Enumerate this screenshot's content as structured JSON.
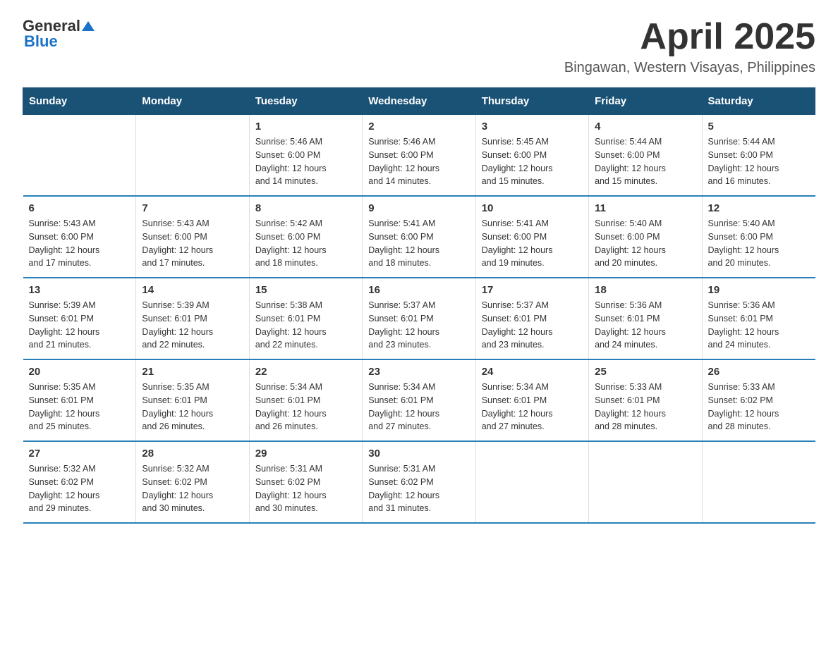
{
  "header": {
    "logo_text_general": "General",
    "logo_text_blue": "Blue",
    "month_title": "April 2025",
    "location": "Bingawan, Western Visayas, Philippines"
  },
  "calendar": {
    "headers": [
      "Sunday",
      "Monday",
      "Tuesday",
      "Wednesday",
      "Thursday",
      "Friday",
      "Saturday"
    ],
    "rows": [
      [
        {
          "day": "",
          "info": ""
        },
        {
          "day": "",
          "info": ""
        },
        {
          "day": "1",
          "info": "Sunrise: 5:46 AM\nSunset: 6:00 PM\nDaylight: 12 hours\nand 14 minutes."
        },
        {
          "day": "2",
          "info": "Sunrise: 5:46 AM\nSunset: 6:00 PM\nDaylight: 12 hours\nand 14 minutes."
        },
        {
          "day": "3",
          "info": "Sunrise: 5:45 AM\nSunset: 6:00 PM\nDaylight: 12 hours\nand 15 minutes."
        },
        {
          "day": "4",
          "info": "Sunrise: 5:44 AM\nSunset: 6:00 PM\nDaylight: 12 hours\nand 15 minutes."
        },
        {
          "day": "5",
          "info": "Sunrise: 5:44 AM\nSunset: 6:00 PM\nDaylight: 12 hours\nand 16 minutes."
        }
      ],
      [
        {
          "day": "6",
          "info": "Sunrise: 5:43 AM\nSunset: 6:00 PM\nDaylight: 12 hours\nand 17 minutes."
        },
        {
          "day": "7",
          "info": "Sunrise: 5:43 AM\nSunset: 6:00 PM\nDaylight: 12 hours\nand 17 minutes."
        },
        {
          "day": "8",
          "info": "Sunrise: 5:42 AM\nSunset: 6:00 PM\nDaylight: 12 hours\nand 18 minutes."
        },
        {
          "day": "9",
          "info": "Sunrise: 5:41 AM\nSunset: 6:00 PM\nDaylight: 12 hours\nand 18 minutes."
        },
        {
          "day": "10",
          "info": "Sunrise: 5:41 AM\nSunset: 6:00 PM\nDaylight: 12 hours\nand 19 minutes."
        },
        {
          "day": "11",
          "info": "Sunrise: 5:40 AM\nSunset: 6:00 PM\nDaylight: 12 hours\nand 20 minutes."
        },
        {
          "day": "12",
          "info": "Sunrise: 5:40 AM\nSunset: 6:00 PM\nDaylight: 12 hours\nand 20 minutes."
        }
      ],
      [
        {
          "day": "13",
          "info": "Sunrise: 5:39 AM\nSunset: 6:01 PM\nDaylight: 12 hours\nand 21 minutes."
        },
        {
          "day": "14",
          "info": "Sunrise: 5:39 AM\nSunset: 6:01 PM\nDaylight: 12 hours\nand 22 minutes."
        },
        {
          "day": "15",
          "info": "Sunrise: 5:38 AM\nSunset: 6:01 PM\nDaylight: 12 hours\nand 22 minutes."
        },
        {
          "day": "16",
          "info": "Sunrise: 5:37 AM\nSunset: 6:01 PM\nDaylight: 12 hours\nand 23 minutes."
        },
        {
          "day": "17",
          "info": "Sunrise: 5:37 AM\nSunset: 6:01 PM\nDaylight: 12 hours\nand 23 minutes."
        },
        {
          "day": "18",
          "info": "Sunrise: 5:36 AM\nSunset: 6:01 PM\nDaylight: 12 hours\nand 24 minutes."
        },
        {
          "day": "19",
          "info": "Sunrise: 5:36 AM\nSunset: 6:01 PM\nDaylight: 12 hours\nand 24 minutes."
        }
      ],
      [
        {
          "day": "20",
          "info": "Sunrise: 5:35 AM\nSunset: 6:01 PM\nDaylight: 12 hours\nand 25 minutes."
        },
        {
          "day": "21",
          "info": "Sunrise: 5:35 AM\nSunset: 6:01 PM\nDaylight: 12 hours\nand 26 minutes."
        },
        {
          "day": "22",
          "info": "Sunrise: 5:34 AM\nSunset: 6:01 PM\nDaylight: 12 hours\nand 26 minutes."
        },
        {
          "day": "23",
          "info": "Sunrise: 5:34 AM\nSunset: 6:01 PM\nDaylight: 12 hours\nand 27 minutes."
        },
        {
          "day": "24",
          "info": "Sunrise: 5:34 AM\nSunset: 6:01 PM\nDaylight: 12 hours\nand 27 minutes."
        },
        {
          "day": "25",
          "info": "Sunrise: 5:33 AM\nSunset: 6:01 PM\nDaylight: 12 hours\nand 28 minutes."
        },
        {
          "day": "26",
          "info": "Sunrise: 5:33 AM\nSunset: 6:02 PM\nDaylight: 12 hours\nand 28 minutes."
        }
      ],
      [
        {
          "day": "27",
          "info": "Sunrise: 5:32 AM\nSunset: 6:02 PM\nDaylight: 12 hours\nand 29 minutes."
        },
        {
          "day": "28",
          "info": "Sunrise: 5:32 AM\nSunset: 6:02 PM\nDaylight: 12 hours\nand 30 minutes."
        },
        {
          "day": "29",
          "info": "Sunrise: 5:31 AM\nSunset: 6:02 PM\nDaylight: 12 hours\nand 30 minutes."
        },
        {
          "day": "30",
          "info": "Sunrise: 5:31 AM\nSunset: 6:02 PM\nDaylight: 12 hours\nand 31 minutes."
        },
        {
          "day": "",
          "info": ""
        },
        {
          "day": "",
          "info": ""
        },
        {
          "day": "",
          "info": ""
        }
      ]
    ]
  }
}
